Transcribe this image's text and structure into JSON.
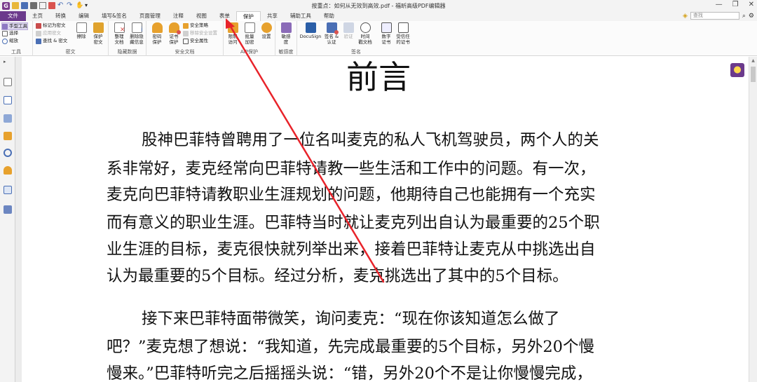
{
  "window": {
    "title": "按重点：如何从无效到高效.pdf - 福昕高级PDF编辑器",
    "logo_text": "G",
    "min_label": "—",
    "restore_label": "❐",
    "close_label": "✕"
  },
  "tabs": [
    "文件",
    "主页",
    "转换",
    "编辑",
    "填写&签名",
    "页面管理",
    "注释",
    "视图",
    "表单",
    "保护",
    "共享",
    "辅助工具",
    "帮助"
  ],
  "search": {
    "placeholder": "查找",
    "icon": "search-icon"
  },
  "ribbon": {
    "tools": {
      "label": "工具",
      "hand": "手型工具",
      "select": "选择",
      "zoom": "缩放"
    },
    "redact": {
      "label": "密文",
      "mark": "标记为密文",
      "apply": "应用密文",
      "search_redact": "查找 & 密文",
      "erase": "擦除",
      "protect": "保护\n密文"
    },
    "hidden": {
      "label": "隐藏数据",
      "sanitize": "整理\n文档",
      "remove_hidden": "删除隐\n藏信息"
    },
    "security": {
      "label": "安全文档",
      "password": "密码\n保护",
      "cert": "证书\n保护",
      "policy": "安全策略",
      "remove": "移除安全设置",
      "props": "安全属性"
    },
    "aip": {
      "label": "AIP保护",
      "restrict": "限制\n访问",
      "batch": "批量\n加密",
      "settings": "设置"
    },
    "sensitivity": {
      "label": "敏感度",
      "sens": "敏感\n度"
    },
    "sign": {
      "label": "签名",
      "docusign": "DocuSign",
      "sign_cert": "签名 &\n认证",
      "validate": "验证",
      "timestamp": "时间\n戳文档",
      "digital_id": "数字\n证书",
      "trusted": "受信任\n的证书"
    }
  },
  "document": {
    "title": "前言",
    "para1": [
      "股神巴菲特曾聘用了一位名叫麦克的私人飞机驾驶员，两个人的关",
      "系非常好，麦克经常向巴菲特请教一些生活和工作中的问题。有一次，",
      "麦克向巴菲特请教职业生涯规划的问题，他期待自己也能拥有一个充实",
      "而有意义的职业生涯。巴菲特当时就让麦克列出自认为最重要的25个职",
      "业生涯的目标，麦克很快就列举出来，接着巴菲特让麦克从中挑选出自",
      "认为最重要的5个目标。经过分析，麦克挑选出了其中的5个目标。"
    ],
    "para2": [
      "接下来巴菲特面带微笑，询问麦克：“现在你该知道怎么做了",
      "吧？”麦克想了想说：“我知道，先完成最重要的5个目标，另外20个慢",
      "慢来。”巴菲特听完之后摇摇头说：“错，另外20个不是让你慢慢完成，"
    ]
  },
  "annotation": {
    "color": "#e8232a"
  },
  "colors": {
    "brand": "#6b3a8c",
    "accent_red": "#e8232a"
  }
}
